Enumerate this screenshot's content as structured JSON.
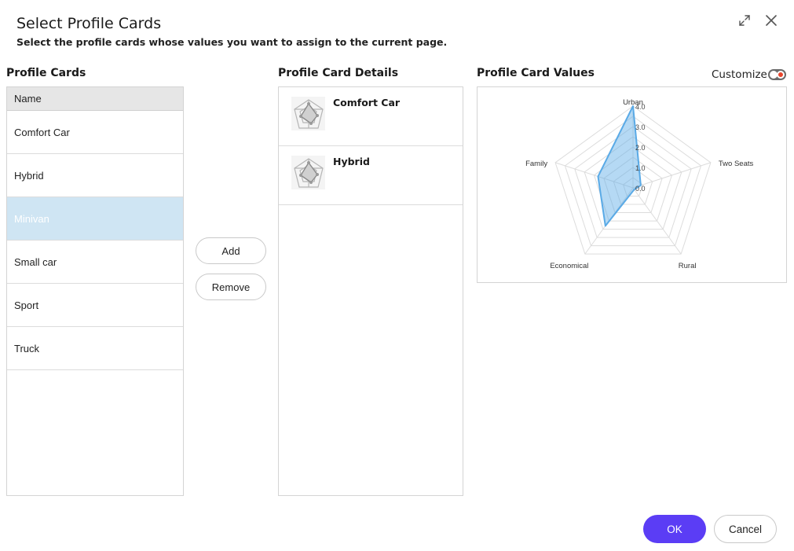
{
  "dialog": {
    "title": "Select Profile Cards",
    "subtitle": "Select the profile cards whose values you want to assign to the current page."
  },
  "profile_cards": {
    "heading": "Profile Cards",
    "column_header": "Name",
    "items": [
      {
        "label": "Comfort Car",
        "selected": false
      },
      {
        "label": "Hybrid",
        "selected": false
      },
      {
        "label": "Minivan",
        "selected": true
      },
      {
        "label": "Small car",
        "selected": false
      },
      {
        "label": "Sport",
        "selected": false
      },
      {
        "label": "Truck",
        "selected": false
      }
    ]
  },
  "actions": {
    "add_label": "Add",
    "remove_label": "Remove"
  },
  "details": {
    "heading": "Profile Card Details",
    "cards": [
      {
        "name": "Comfort Car",
        "icon": "radar-chart-thumbnail-icon"
      },
      {
        "name": "Hybrid",
        "icon": "radar-chart-thumbnail-icon"
      }
    ]
  },
  "values": {
    "heading": "Profile Card Values",
    "customize_label": "Customize",
    "customize_on": false
  },
  "chart_data": {
    "type": "radar",
    "axes": [
      "Urban",
      "Two Seats",
      "Rural",
      "Economical",
      "Family"
    ],
    "tick_labels": [
      "0.0",
      "1.0",
      "2.0",
      "3.0",
      "4.0"
    ],
    "range": [
      0,
      4
    ],
    "series": [
      {
        "values": [
          4.0,
          0.4,
          0.1,
          2.3,
          1.8
        ],
        "color": "#5aaae6"
      }
    ],
    "grid": true
  },
  "footer": {
    "ok_label": "OK",
    "cancel_label": "Cancel",
    "accent": "#5b3df5"
  }
}
